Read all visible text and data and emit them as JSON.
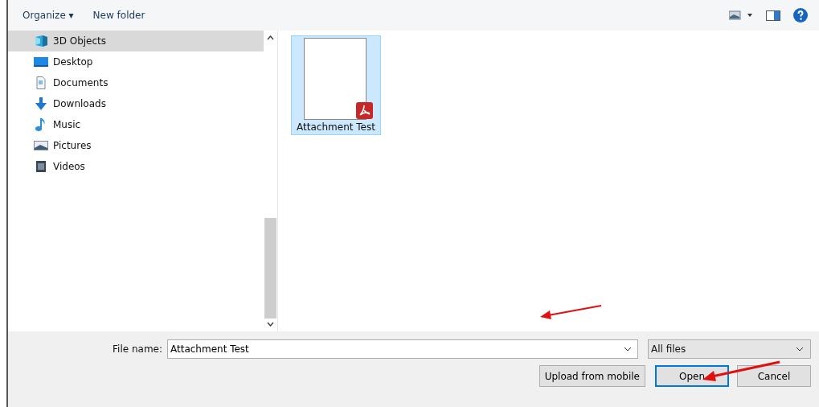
{
  "toolbar": {
    "organize": "Organize ▾",
    "new_folder": "New folder"
  },
  "sidebar": {
    "items": [
      {
        "label": "3D Objects",
        "kind": "cube",
        "selected": true
      },
      {
        "label": "Desktop",
        "kind": "desktop",
        "selected": false
      },
      {
        "label": "Documents",
        "kind": "document",
        "selected": false
      },
      {
        "label": "Downloads",
        "kind": "download",
        "selected": false
      },
      {
        "label": "Music",
        "kind": "music",
        "selected": false
      },
      {
        "label": "Pictures",
        "kind": "pictures",
        "selected": false
      },
      {
        "label": "Videos",
        "kind": "videos",
        "selected": false
      }
    ]
  },
  "files": [
    {
      "name": "Attachment Test",
      "selected": true
    }
  ],
  "footer": {
    "file_name_label": "File name:",
    "file_name_value": "Attachment Test",
    "file_type": "All files",
    "buttons": [
      {
        "label": "Upload from mobile",
        "kind": "plain"
      },
      {
        "label": "Open",
        "kind": "default"
      },
      {
        "label": "Cancel",
        "kind": "plain"
      }
    ]
  }
}
